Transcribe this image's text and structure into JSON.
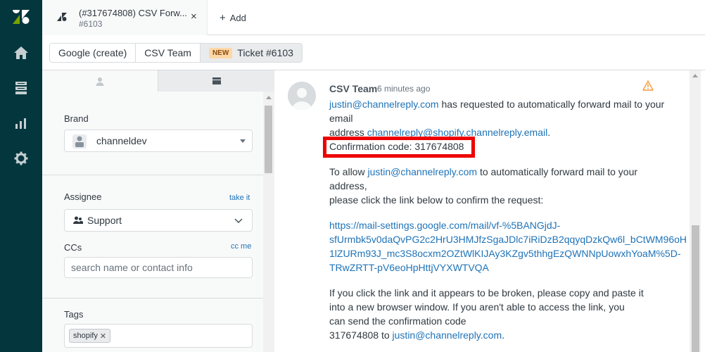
{
  "rail": {
    "items": [
      {
        "icon": "home-icon"
      },
      {
        "icon": "views-icon"
      },
      {
        "icon": "reporting-icon"
      },
      {
        "icon": "admin-gear-icon"
      }
    ]
  },
  "tabbar": {
    "tab_title": "(#317674808) CSV Forw...",
    "tab_subtitle": "#6103",
    "close": "×",
    "add_label": "Add",
    "add_plus": "+"
  },
  "breadcrumbs": {
    "items": [
      "Google (create)",
      "CSV Team"
    ],
    "new_badge": "NEW",
    "ticket_label": "Ticket #6103"
  },
  "sidebar": {
    "brand_label": "Brand",
    "brand_value": "channeldev",
    "assignee_label": "Assignee",
    "take_it": "take it",
    "assignee_value": "Support",
    "ccs_label": "CCs",
    "cc_me": "cc me",
    "ccs_placeholder": "search name or contact info",
    "tags_label": "Tags",
    "tags": [
      "shopify"
    ]
  },
  "message": {
    "sender": "CSV Team",
    "time": "6 minutes ago",
    "p1_email": "justin@channelreply.com",
    "p1_text_a": " has requested to automatically forward mail to your email",
    "p1_text_b": "address ",
    "p1_address": "channelreply@shopify.channelreply.email",
    "p1_text_c": ".",
    "confirmation": "Confirmation code: 317674808",
    "p2_text_a": "To allow ",
    "p2_email": "justin@channelreply.com",
    "p2_text_b": " to automatically forward mail to your address,",
    "p2_text_c": "please click the link below to confirm the request:",
    "link_l1": "https://mail-settings.google.com/mail/vf-%5BANGjdJ-",
    "link_l2": "sfUrmbk5v0daQvPG2c2HrU3HMJfzSgaJDlc7iRiDzB2qqyqDzkQw6l_bCtWM96oH",
    "link_l3": "1lZURm93J_mc3S8ocxm2OZtWlKIJAy3KZgv5thhgEzQWNNpUowxhYoaM%5D-",
    "link_l4": "TRwZRTT-pV6eoHpHttjVYXWTVQA",
    "p3_l1": "If you click the link and it appears to be broken, please copy and paste it",
    "p3_l2": "into a new browser window. If you aren't able to access the link, you",
    "p3_l3": "can send the confirmation code",
    "p3_l4a": "317674808 to ",
    "p3_email": "justin@channelreply.com",
    "p3_l4b": "."
  },
  "colors": {
    "rail_bg": "#03363d",
    "link": "#1f73b7",
    "highlight_border": "#e00000",
    "logo_green": "#78a300"
  }
}
